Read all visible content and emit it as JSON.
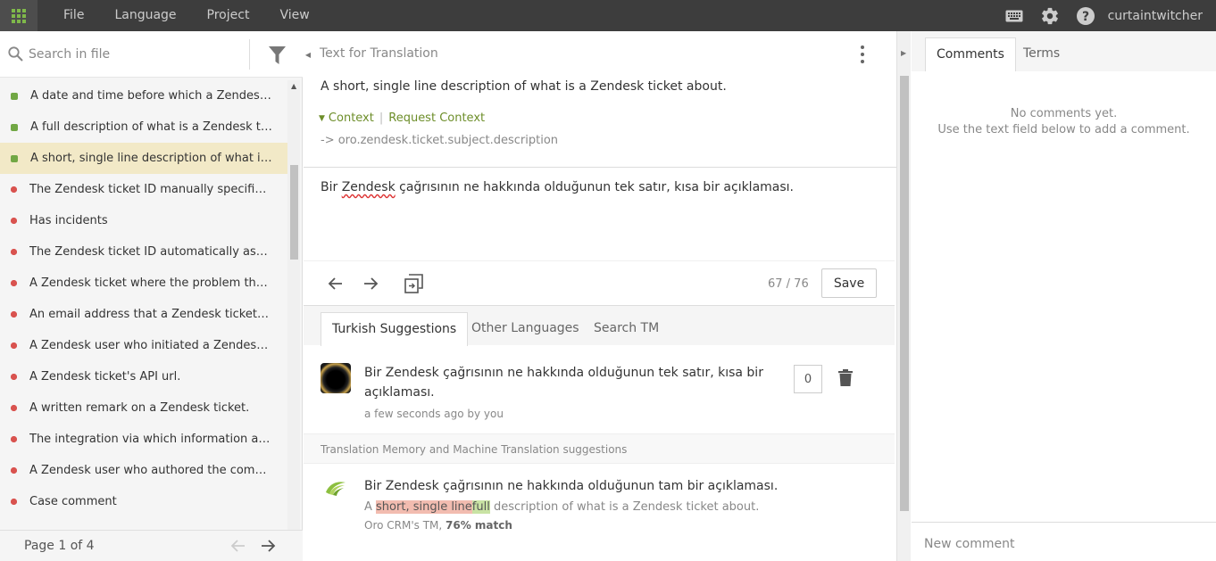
{
  "topbar": {
    "menu": [
      "File",
      "Language",
      "Project",
      "View"
    ],
    "username": "curtaintwitcher",
    "accent": "#7fb84a"
  },
  "sidebar": {
    "search_placeholder": "Search in file",
    "items": [
      {
        "text": "A date and time before which a Zendesk tic...",
        "status": "green"
      },
      {
        "text": "A full description of what is a Zendesk ticke...",
        "status": "green"
      },
      {
        "text": "A short, single line description of what is a ...",
        "status": "green",
        "active": true
      },
      {
        "text": "The Zendesk ticket ID manually specified o...",
        "status": "red"
      },
      {
        "text": "Has incidents",
        "status": "red"
      },
      {
        "text": "The Zendesk ticket ID automatically assigne...",
        "status": "red"
      },
      {
        "text": "A Zendesk ticket where the problem that le...",
        "status": "red"
      },
      {
        "text": "An email address that a Zendesk ticket upd...",
        "status": "red"
      },
      {
        "text": "A Zendesk user who initiated a Zendesk tick...",
        "status": "red"
      },
      {
        "text": "A Zendesk ticket's API url.",
        "status": "red"
      },
      {
        "text": "A written remark on a Zendesk ticket.",
        "status": "red"
      },
      {
        "text": "The integration via which information abou...",
        "status": "red"
      },
      {
        "text": "A Zendesk user who authored the comment.",
        "status": "red"
      },
      {
        "text": "Case comment",
        "status": "red"
      },
      {
        "text": "",
        "status": "red"
      }
    ],
    "page_label": "Page 1 of 4"
  },
  "editor": {
    "title": "Text for Translation",
    "source": "A short, single line description of what is a Zendesk ticket about.",
    "context_label": "Context",
    "request_context_label": "Request Context",
    "context_key": "-> oro.zendesk.ticket.subject.description",
    "translation_before": "Bir ",
    "translation_misspelled": "Zendesk",
    "translation_after": " çağrısının ne hakkında olduğunun tek satır, kısa bir açıklaması.",
    "counter": "67 / 76",
    "save_label": "Save"
  },
  "suggestions": {
    "tabs": [
      "Turkish Suggestions",
      "Other Languages",
      "Search TM"
    ],
    "items": [
      {
        "text": "Bir Zendesk çağrısının ne hakkında olduğunun tek satır, kısa bir açıklaması.",
        "meta": "a few seconds ago by you",
        "votes": "0"
      }
    ],
    "tm_header": "Translation Memory and Machine Translation suggestions",
    "tm": {
      "text": "Bir Zendesk çağrısının ne hakkında olduğunun tam bir açıklaması.",
      "source_prefix": "A ",
      "source_deleted": "short, single line",
      "source_inserted": "full",
      "source_suffix": " description of what is a Zendesk ticket about.",
      "origin_prefix": "Oro CRM's TM, ",
      "origin_match": "76% match"
    }
  },
  "comments": {
    "tabs": [
      "Comments",
      "Terms"
    ],
    "empty_line1": "No comments yet.",
    "empty_line2": "Use the text field below to add a comment.",
    "input_placeholder": "New comment"
  }
}
